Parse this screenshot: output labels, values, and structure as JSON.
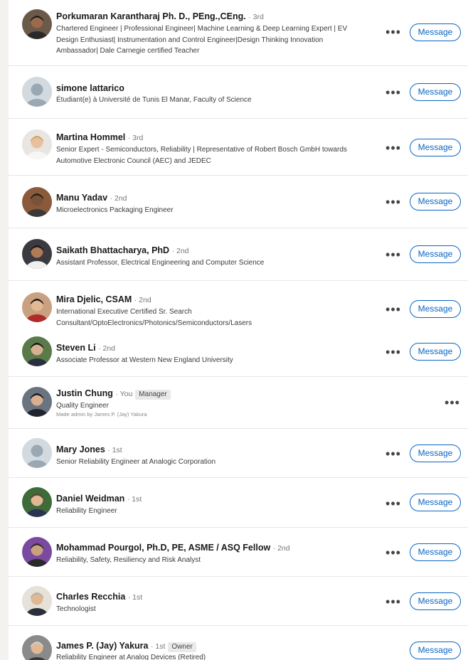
{
  "members": [
    {
      "name": "Porkumaran Karantharaj Ph. D., PEng.,CEng.",
      "degree": "· 3rd",
      "badge": "",
      "headline_lines": [
        "Chartered Engineer | Professional Engineer| Machine Learning & Deep Learning Expert | EV",
        "Design Enthusiast| Instrumentation and Control Engineer|Design Thinking Innovation",
        "Ambassador| Dale Carnegie certified Teacher"
      ],
      "note": "",
      "more": "•••",
      "button": "Message",
      "avatar": {
        "bg": "#6b5a4a",
        "skin": "#9a6a4a",
        "shirt": "#2a2a2a",
        "hair": "#1c1c1c"
      }
    },
    {
      "name": "simone lattarico",
      "degree": "",
      "badge": "",
      "headline_lines": [
        "Étudiant(e) à Université de Tunis El Manar, Faculty of Science"
      ],
      "note": "",
      "more": "•••",
      "button": "Message",
      "avatar": {
        "bg": "#d2dae0",
        "skin": "#9aa8b3",
        "shirt": "#9aa8b3",
        "hair": ""
      }
    },
    {
      "name": "Martina Hommel",
      "degree": "· 3rd",
      "badge": "",
      "headline_lines": [
        "Senior Expert - Semiconductors, Reliability | Representative of Robert Bosch GmbH towards",
        "Automotive Electronic Council (AEC) and JEDEC"
      ],
      "note": "",
      "more": "•••",
      "button": "Message",
      "avatar": {
        "bg": "#e9e6e2",
        "skin": "#e8c0a0",
        "shirt": "#f6f6f6",
        "hair": "#c9a76a"
      }
    },
    {
      "name": "Manu Yadav",
      "degree": "· 2nd",
      "badge": "",
      "headline_lines": [
        "Microelectronics Packaging Engineer"
      ],
      "note": "",
      "more": "•••",
      "button": "Message",
      "avatar": {
        "bg": "#8a5a3a",
        "skin": "#7a5238",
        "shirt": "#3a3a3a",
        "hair": "#1e1e1e"
      }
    },
    {
      "name": "Saikath Bhattacharya, PhD",
      "degree": "· 2nd",
      "badge": "",
      "headline_lines": [
        "Assistant Professor, Electrical Engineering and Computer Science"
      ],
      "note": "",
      "more": "•••",
      "button": "Message",
      "avatar": {
        "bg": "#3a3a40",
        "skin": "#b07a55",
        "shirt": "#f0f0f0",
        "hair": "#151515"
      }
    },
    {
      "name": "Mira Djelic, CSAM",
      "degree": "· 2nd",
      "badge": "",
      "headline_lines": [
        "International Executive Certified Sr. Search",
        "Consultant/OptoElectronics/Photonics/Semiconductors/Lasers"
      ],
      "note": "",
      "more": "•••",
      "button": "Message",
      "avatar": {
        "bg": "#c9a080",
        "skin": "#e3b894",
        "shirt": "#b02a2a",
        "hair": "#161616"
      }
    },
    {
      "name": "Steven Li",
      "degree": "· 2nd",
      "badge": "",
      "headline_lines": [
        "Associate Professor at Western New England University"
      ],
      "note": "",
      "more": "•••",
      "button": "Message",
      "avatar": {
        "bg": "#5a7a4a",
        "skin": "#d8b090",
        "shirt": "#2a3040",
        "hair": "#161616"
      }
    },
    {
      "name": "Justin Chung",
      "degree": "· You",
      "badge": "Manager",
      "headline_lines": [
        "Quality Engineer"
      ],
      "note": "Made admin by James P. (Jay) Yakura",
      "more": "•••",
      "button": "",
      "avatar": {
        "bg": "#6a7480",
        "skin": "#d8b090",
        "shirt": "#20242c",
        "hair": "#141414"
      }
    },
    {
      "name": "Mary Jones",
      "degree": "· 1st",
      "badge": "",
      "headline_lines": [
        "Senior Reliability Engineer at Analogic Corporation"
      ],
      "note": "",
      "more": "•••",
      "button": "Message",
      "avatar": {
        "bg": "#d2dae0",
        "skin": "#9aa8b3",
        "shirt": "#9aa8b3",
        "hair": ""
      }
    },
    {
      "name": "Daniel Weidman",
      "degree": "· 1st",
      "badge": "",
      "headline_lines": [
        "Reliability Engineer"
      ],
      "note": "",
      "more": "•••",
      "button": "Message",
      "avatar": {
        "bg": "#3f6a3a",
        "skin": "#e0b894",
        "shirt": "#2a3450",
        "hair": "#5a4030"
      }
    },
    {
      "name": "Mohammad Pourgol, Ph.D, PE, ASME / ASQ Fellow",
      "degree": "· 2nd",
      "badge": "",
      "headline_lines": [
        "Reliability, Safety, Resiliency and Risk Analyst"
      ],
      "note": "",
      "more": "•••",
      "button": "Message",
      "avatar": {
        "bg": "#7a4aa0",
        "skin": "#caa080",
        "shirt": "#2a2a2a",
        "hair": "#2a2a2a"
      }
    },
    {
      "name": "Charles Recchia",
      "degree": "· 1st",
      "badge": "",
      "headline_lines": [
        "Technologist"
      ],
      "note": "",
      "more": "•••",
      "button": "Message",
      "avatar": {
        "bg": "#e6e2da",
        "skin": "#e0b894",
        "shirt": "#2a2f3a",
        "hair": "#b8b0a0"
      }
    },
    {
      "name": "James P. (Jay) Yakura",
      "degree": "· 1st",
      "badge": "Owner",
      "headline_lines": [
        "Reliability Engineer at Analog Devices (Retired)"
      ],
      "note": "",
      "more": "",
      "button": "Message",
      "avatar": {
        "bg": "#8a8a8a",
        "skin": "#e0b894",
        "shirt": "#3a3a3a",
        "hair": "#d0d0d0"
      }
    }
  ],
  "colors": {
    "accent": "#0a66c2",
    "background": "#f4f2ee",
    "card": "#ffffff"
  }
}
